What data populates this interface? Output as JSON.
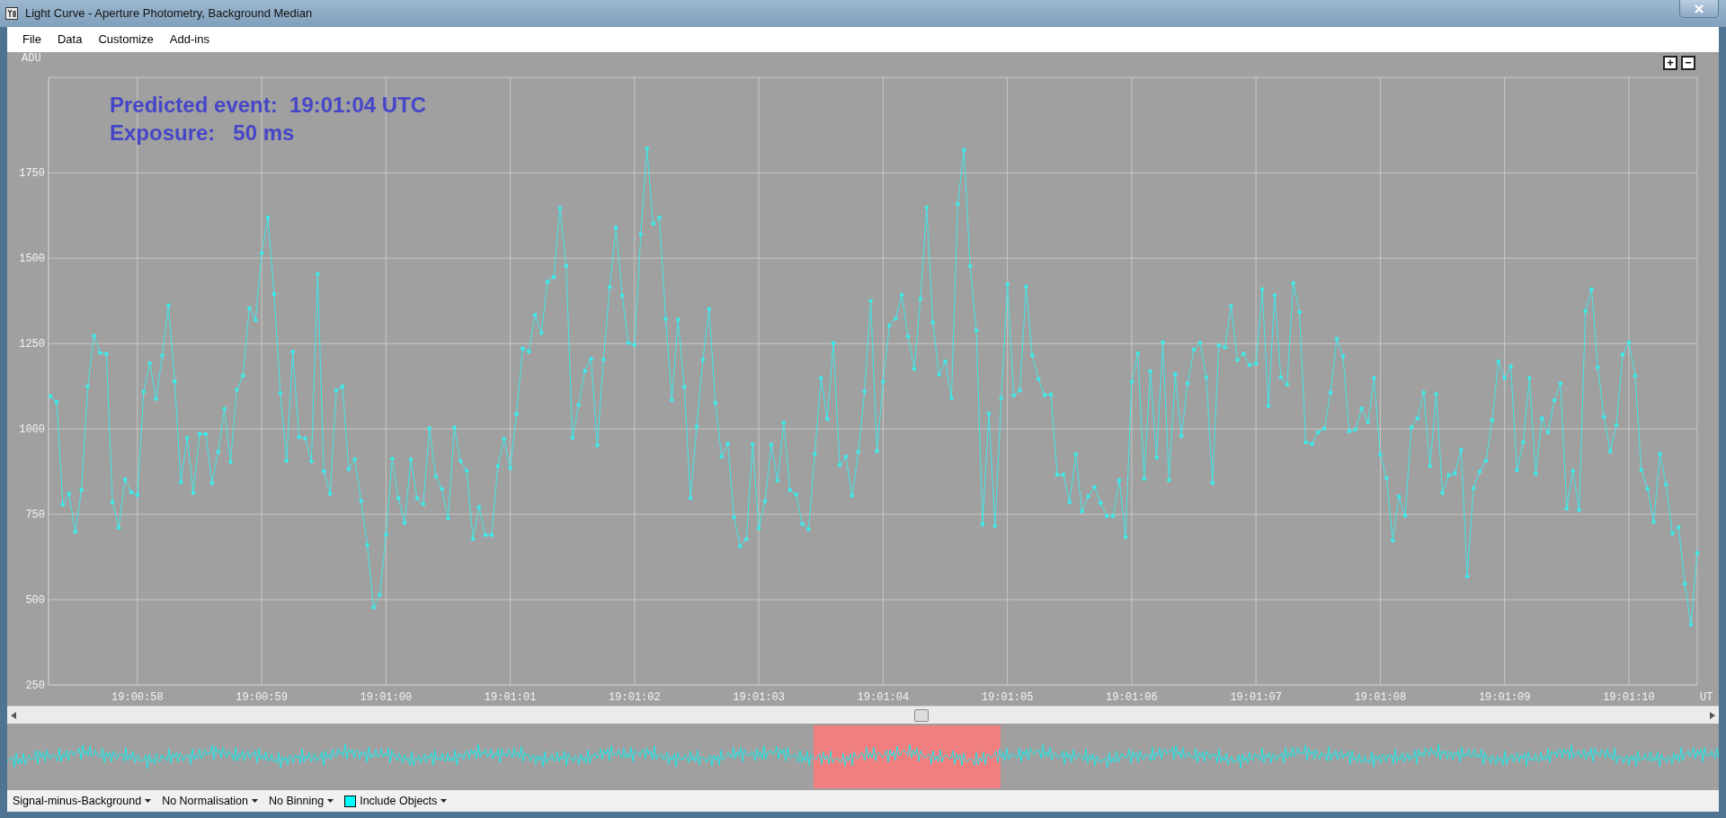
{
  "window": {
    "title": "Light Curve - Aperture Photometry, Background Median"
  },
  "menu": [
    "File",
    "Data",
    "Customize",
    "Add-ins"
  ],
  "chart": {
    "zoom_buttons": [
      "+",
      "−"
    ],
    "chart_data": {
      "type": "line",
      "xlabel": "UT",
      "ylabel": "ADU",
      "grid": true,
      "ylim": [
        250,
        2030
      ],
      "categories": [
        null,
        null,
        null,
        null,
        null,
        null,
        null,
        null,
        null,
        null,
        null,
        null,
        null,
        null,
        "19:00:58",
        null,
        null,
        null,
        null,
        null,
        null,
        null,
        null,
        null,
        null,
        null,
        null,
        null,
        null,
        null,
        null,
        null,
        null,
        null,
        "19:00:59",
        null,
        null,
        null,
        null,
        null,
        null,
        null,
        null,
        null,
        null,
        null,
        null,
        null,
        null,
        null,
        null,
        null,
        null,
        null,
        "19:01:00",
        null,
        null,
        null,
        null,
        null,
        null,
        null,
        null,
        null,
        null,
        null,
        null,
        null,
        null,
        null,
        null,
        null,
        null,
        null,
        "19:01:01",
        null,
        null,
        null,
        null,
        null,
        null,
        null,
        null,
        null,
        null,
        null,
        null,
        null,
        null,
        null,
        null,
        null,
        null,
        null,
        "19:01:02",
        null,
        null,
        null,
        null,
        null,
        null,
        null,
        null,
        null,
        null,
        null,
        null,
        null,
        null,
        null,
        null,
        null,
        null,
        null,
        "19:01:03",
        null,
        null,
        null,
        null,
        null,
        null,
        null,
        null,
        null,
        null,
        null,
        null,
        null,
        null,
        null,
        null,
        null,
        null,
        null,
        "19:01:04",
        null,
        null,
        null,
        null,
        null,
        null,
        null,
        null,
        null,
        null,
        null,
        null,
        null,
        null,
        null,
        null,
        null,
        null,
        null,
        "19:01:05",
        null,
        null,
        null,
        null,
        null,
        null,
        null,
        null,
        null,
        null,
        null,
        null,
        null,
        null,
        null,
        null,
        null,
        null,
        null,
        "19:01:06",
        null,
        null,
        null,
        null,
        null,
        null,
        null,
        null,
        null,
        null,
        null,
        null,
        null,
        null,
        null,
        null,
        null,
        null,
        null,
        "19:01:07",
        null,
        null,
        null,
        null,
        null,
        null,
        null,
        null,
        null,
        null,
        null,
        null,
        null,
        null,
        null,
        null,
        null,
        null,
        null,
        "19:01:08",
        null,
        null,
        null,
        null,
        null,
        null,
        null,
        null,
        null,
        null,
        null,
        null,
        null,
        null,
        null,
        null,
        null,
        null,
        null,
        "19:01:09",
        null,
        null,
        null,
        null,
        null,
        null,
        null,
        null,
        null,
        null,
        null,
        null,
        null,
        null,
        null,
        null,
        null,
        null,
        null,
        "19:01:10",
        null,
        null,
        null,
        null,
        null,
        null,
        null,
        null,
        null,
        null,
        null
      ],
      "yticks": [
        250,
        500,
        750,
        1000,
        1250,
        1500,
        1750
      ],
      "annotations": [
        "Predicted event:  19:01:04 UTC",
        "Exposure:   50 ms"
      ],
      "series": [
        {
          "color": "#40e8e8",
          "values": [
            1096,
            1079,
            778,
            810,
            699,
            821,
            1124,
            1273,
            1223,
            1220,
            785,
            710,
            852,
            815,
            806,
            1109,
            1192,
            1088,
            1215,
            1362,
            1139,
            844,
            974,
            813,
            985,
            985,
            841,
            933,
            1059,
            903,
            1115,
            1156,
            1354,
            1319,
            1515,
            1619,
            1395,
            1105,
            907,
            1226,
            976,
            972,
            905,
            1454,
            876,
            810,
            1113,
            1124,
            882,
            911,
            789,
            660,
            477,
            514,
            691,
            913,
            797,
            725,
            911,
            797,
            780,
            1002,
            861,
            824,
            738,
            1004,
            905,
            878,
            678,
            771,
            689,
            689,
            891,
            971,
            885,
            1043,
            1235,
            1226,
            1334,
            1281,
            1431,
            1445,
            1647,
            1478,
            974,
            1070,
            1170,
            1205,
            952,
            1203,
            1415,
            1590,
            1391,
            1252,
            1246,
            1570,
            1821,
            1601,
            1619,
            1322,
            1085,
            1320,
            1123,
            797,
            1007,
            1203,
            1351,
            1077,
            919,
            957,
            741,
            656,
            677,
            955,
            709,
            788,
            954,
            849,
            1018,
            821,
            808,
            721,
            706,
            927,
            1149,
            1029,
            1251,
            894,
            919,
            804,
            933,
            1109,
            1375,
            935,
            1138,
            1303,
            1323,
            1393,
            1271,
            1176,
            1381,
            1648,
            1312,
            1159,
            1198,
            1090,
            1659,
            1817,
            1477,
            1288,
            721,
            1045,
            716,
            1090,
            1423,
            1098,
            1113,
            1417,
            1216,
            1146,
            1099,
            1101,
            866,
            866,
            785,
            926,
            758,
            802,
            830,
            783,
            745,
            745,
            850,
            684,
            1138,
            1221,
            854,
            1168,
            916,
            1254,
            850,
            1160,
            979,
            1133,
            1232,
            1253,
            1151,
            842,
            1245,
            1239,
            1360,
            1202,
            1220,
            1187,
            1192,
            1409,
            1067,
            1391,
            1151,
            1130,
            1427,
            1342,
            961,
            956,
            990,
            1001,
            1106,
            1264,
            1212,
            993,
            998,
            1060,
            1020,
            1149,
            925,
            856,
            673,
            802,
            746,
            1004,
            1031,
            1106,
            891,
            1102,
            812,
            864,
            870,
            939,
            568,
            826,
            875,
            907,
            1025,
            1197,
            1149,
            1183,
            879,
            961,
            1149,
            869,
            1031,
            990,
            1084,
            1133,
            767,
            877,
            762,
            1345,
            1409,
            1180,
            1035,
            934,
            1011,
            1218,
            1253,
            1156,
            880,
            825,
            728,
            927,
            837,
            694,
            712,
            546,
            427,
            637
          ]
        }
      ]
    }
  },
  "toolbar": [
    {
      "kind": "dropdown",
      "label": "Signal-minus-Background"
    },
    {
      "kind": "dropdown",
      "label": "No Normalisation"
    },
    {
      "kind": "dropdown",
      "label": "No Binning"
    },
    {
      "kind": "swatch-dropdown",
      "label": "Include Objects"
    }
  ]
}
